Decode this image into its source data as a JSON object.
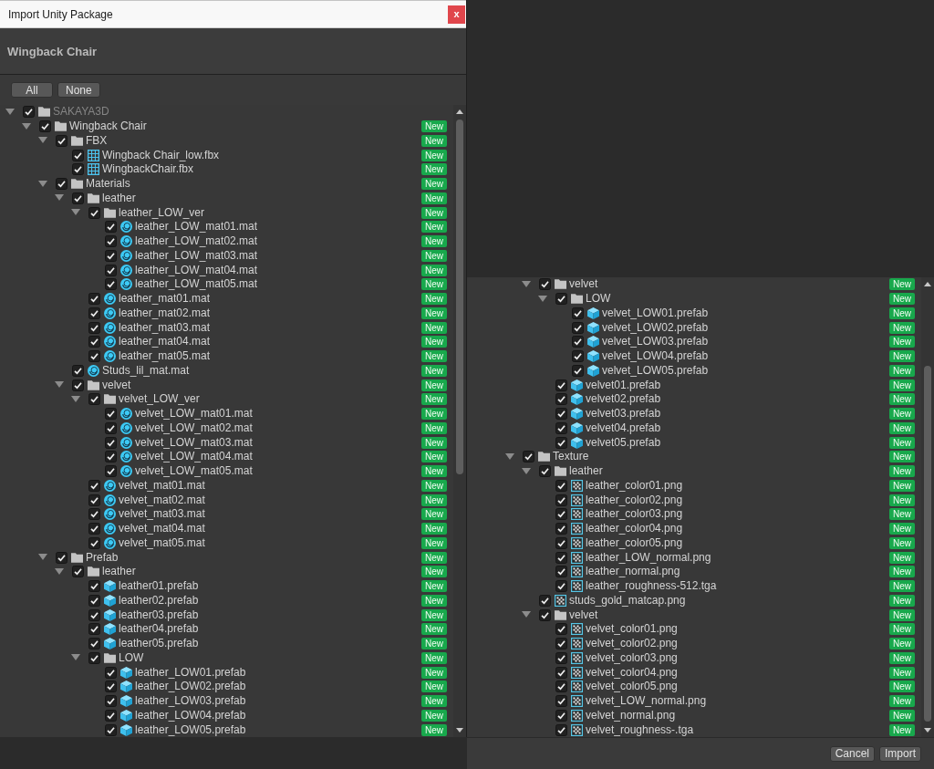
{
  "dialog_top": {
    "window": {
      "title": "Import Unity Package",
      "close": "x"
    },
    "package_title": "Wingback Chair",
    "buttons": [
      "All",
      "None"
    ],
    "tree": [
      {
        "label": "SAKAYA3D",
        "kind": "folder",
        "checked": true,
        "disabled": true,
        "expanded": true,
        "children": [
          {
            "label": "Wingback Chair",
            "kind": "folder",
            "checked": true,
            "disabled": false,
            "badge": "New",
            "expanded": true,
            "children": [
              {
                "label": "FBX",
                "kind": "folder",
                "checked": true,
                "disabled": false,
                "badge": "New",
                "expanded": true,
                "children": [
                  {
                    "label": "Wingback Chair_low.fbx",
                    "kind": "model",
                    "checked": true,
                    "disabled": false,
                    "badge": "New"
                  },
                  {
                    "label": "WingbackChair.fbx",
                    "kind": "model",
                    "checked": true,
                    "disabled": false,
                    "badge": "New"
                  }
                ]
              },
              {
                "label": "Materials",
                "kind": "folder",
                "checked": true,
                "disabled": false,
                "badge": "New",
                "expanded": true,
                "children": [
                  {
                    "label": "leather",
                    "kind": "folder",
                    "checked": true,
                    "disabled": false,
                    "badge": "New",
                    "expanded": true,
                    "children": [
                      {
                        "label": "leather_LOW_ver",
                        "kind": "folder",
                        "checked": true,
                        "disabled": false,
                        "badge": "New",
                        "expanded": true,
                        "children": [
                          {
                            "label": "leather_LOW_mat01.mat",
                            "kind": "material",
                            "checked": true,
                            "disabled": false,
                            "badge": "New"
                          },
                          {
                            "label": "leather_LOW_mat02.mat",
                            "kind": "material",
                            "checked": true,
                            "disabled": false,
                            "badge": "New"
                          },
                          {
                            "label": "leather_LOW_mat03.mat",
                            "kind": "material",
                            "checked": true,
                            "disabled": false,
                            "badge": "New"
                          },
                          {
                            "label": "leather_LOW_mat04.mat",
                            "kind": "material",
                            "checked": true,
                            "disabled": false,
                            "badge": "New"
                          },
                          {
                            "label": "leather_LOW_mat05.mat",
                            "kind": "material",
                            "checked": true,
                            "disabled": false,
                            "badge": "New"
                          }
                        ]
                      },
                      {
                        "label": "leather_mat01.mat",
                        "kind": "material",
                        "checked": true,
                        "disabled": false,
                        "badge": "New"
                      },
                      {
                        "label": "leather_mat02.mat",
                        "kind": "material",
                        "checked": true,
                        "disabled": false,
                        "badge": "New"
                      },
                      {
                        "label": "leather_mat03.mat",
                        "kind": "material",
                        "checked": true,
                        "disabled": false,
                        "badge": "New"
                      },
                      {
                        "label": "leather_mat04.mat",
                        "kind": "material",
                        "checked": true,
                        "disabled": false,
                        "badge": "New"
                      },
                      {
                        "label": "leather_mat05.mat",
                        "kind": "material",
                        "checked": true,
                        "disabled": false,
                        "badge": "New"
                      }
                    ]
                  },
                  {
                    "label": "Studs_lil_mat.mat",
                    "kind": "material",
                    "checked": true,
                    "disabled": false,
                    "badge": "New"
                  },
                  {
                    "label": "velvet",
                    "kind": "folder",
                    "checked": true,
                    "disabled": false,
                    "badge": "New",
                    "expanded": true,
                    "children": [
                      {
                        "label": "velvet_LOW_ver",
                        "kind": "folder",
                        "checked": true,
                        "disabled": false,
                        "badge": "New",
                        "expanded": true,
                        "children": [
                          {
                            "label": "velvet_LOW_mat01.mat",
                            "kind": "material",
                            "checked": true,
                            "disabled": false,
                            "badge": "New"
                          },
                          {
                            "label": "velvet_LOW_mat02.mat",
                            "kind": "material",
                            "checked": true,
                            "disabled": false,
                            "badge": "New"
                          },
                          {
                            "label": "velvet_LOW_mat03.mat",
                            "kind": "material",
                            "checked": true,
                            "disabled": false,
                            "badge": "New"
                          },
                          {
                            "label": "velvet_LOW_mat04.mat",
                            "kind": "material",
                            "checked": true,
                            "disabled": false,
                            "badge": "New"
                          },
                          {
                            "label": "velvet_LOW_mat05.mat",
                            "kind": "material",
                            "checked": true,
                            "disabled": false,
                            "badge": "New"
                          }
                        ]
                      },
                      {
                        "label": "velvet_mat01.mat",
                        "kind": "material",
                        "checked": true,
                        "disabled": false,
                        "badge": "New"
                      },
                      {
                        "label": "velvet_mat02.mat",
                        "kind": "material",
                        "checked": true,
                        "disabled": false,
                        "badge": "New"
                      },
                      {
                        "label": "velvet_mat03.mat",
                        "kind": "material",
                        "checked": true,
                        "disabled": false,
                        "badge": "New"
                      },
                      {
                        "label": "velvet_mat04.mat",
                        "kind": "material",
                        "checked": true,
                        "disabled": false,
                        "badge": "New"
                      },
                      {
                        "label": "velvet_mat05.mat",
                        "kind": "material",
                        "checked": true,
                        "disabled": false,
                        "badge": "New"
                      }
                    ]
                  }
                ]
              },
              {
                "label": "Prefab",
                "kind": "folder",
                "checked": true,
                "disabled": false,
                "badge": "New",
                "expanded": true,
                "children": [
                  {
                    "label": "leather",
                    "kind": "folder",
                    "checked": true,
                    "disabled": false,
                    "badge": "New",
                    "expanded": true,
                    "children": [
                      {
                        "label": "leather01.prefab",
                        "kind": "prefab",
                        "checked": true,
                        "disabled": false,
                        "badge": "New"
                      },
                      {
                        "label": "leather02.prefab",
                        "kind": "prefab",
                        "checked": true,
                        "disabled": false,
                        "badge": "New"
                      },
                      {
                        "label": "leather03.prefab",
                        "kind": "prefab",
                        "checked": true,
                        "disabled": false,
                        "badge": "New"
                      },
                      {
                        "label": "leather04.prefab",
                        "kind": "prefab",
                        "checked": true,
                        "disabled": false,
                        "badge": "New"
                      },
                      {
                        "label": "leather05.prefab",
                        "kind": "prefab",
                        "checked": true,
                        "disabled": false,
                        "badge": "New"
                      },
                      {
                        "label": "LOW",
                        "kind": "folder",
                        "checked": true,
                        "disabled": false,
                        "badge": "New",
                        "expanded": true,
                        "children": [
                          {
                            "label": "leather_LOW01.prefab",
                            "kind": "prefab",
                            "checked": true,
                            "disabled": false,
                            "badge": "New"
                          },
                          {
                            "label": "leather_LOW02.prefab",
                            "kind": "prefab",
                            "checked": true,
                            "disabled": false,
                            "badge": "New"
                          },
                          {
                            "label": "leather_LOW03.prefab",
                            "kind": "prefab",
                            "checked": true,
                            "disabled": false,
                            "badge": "New"
                          },
                          {
                            "label": "leather_LOW04.prefab",
                            "kind": "prefab",
                            "checked": true,
                            "disabled": false,
                            "badge": "New"
                          },
                          {
                            "label": "leather_LOW05.prefab",
                            "kind": "prefab",
                            "checked": true,
                            "disabled": false,
                            "badge": "New"
                          }
                        ]
                      }
                    ]
                  }
                ]
              }
            ]
          }
        ]
      }
    ]
  },
  "dialog_scrolled": {
    "tree": [
      {
        "children": [
          {
            "children": [
              {
                "children": [
                  {
                    "label": "velvet",
                    "kind": "folder",
                    "checked": true,
                    "disabled": false,
                    "badge": "New",
                    "expanded": true,
                    "children": [
                      {
                        "label": "LOW",
                        "kind": "folder",
                        "checked": true,
                        "disabled": false,
                        "badge": "New",
                        "expanded": true,
                        "children": [
                          {
                            "label": "velvet_LOW01.prefab",
                            "kind": "prefab",
                            "checked": true,
                            "disabled": false,
                            "badge": "New"
                          },
                          {
                            "label": "velvet_LOW02.prefab",
                            "kind": "prefab",
                            "checked": true,
                            "disabled": false,
                            "badge": "New"
                          },
                          {
                            "label": "velvet_LOW03.prefab",
                            "kind": "prefab",
                            "checked": true,
                            "disabled": false,
                            "badge": "New"
                          },
                          {
                            "label": "velvet_LOW04.prefab",
                            "kind": "prefab",
                            "checked": true,
                            "disabled": false,
                            "badge": "New"
                          },
                          {
                            "label": "velvet_LOW05.prefab",
                            "kind": "prefab",
                            "checked": true,
                            "disabled": false,
                            "badge": "New"
                          }
                        ]
                      },
                      {
                        "label": "velvet01.prefab",
                        "kind": "prefab",
                        "checked": true,
                        "disabled": false,
                        "badge": "New"
                      },
                      {
                        "label": "velvet02.prefab",
                        "kind": "prefab",
                        "checked": true,
                        "disabled": false,
                        "badge": "New"
                      },
                      {
                        "label": "velvet03.prefab",
                        "kind": "prefab",
                        "checked": true,
                        "disabled": false,
                        "badge": "New"
                      },
                      {
                        "label": "velvet04.prefab",
                        "kind": "prefab",
                        "checked": true,
                        "disabled": false,
                        "badge": "New"
                      },
                      {
                        "label": "velvet05.prefab",
                        "kind": "prefab",
                        "checked": true,
                        "disabled": false,
                        "badge": "New"
                      }
                    ]
                  }
                ]
              },
              {
                "label": "Texture",
                "kind": "folder",
                "checked": true,
                "disabled": false,
                "badge": "New",
                "expanded": true,
                "children": [
                  {
                    "label": "leather",
                    "kind": "folder",
                    "checked": true,
                    "disabled": false,
                    "badge": "New",
                    "expanded": true,
                    "children": [
                      {
                        "label": "leather_color01.png",
                        "kind": "texture",
                        "checked": true,
                        "disabled": false,
                        "badge": "New"
                      },
                      {
                        "label": "leather_color02.png",
                        "kind": "texture",
                        "checked": true,
                        "disabled": false,
                        "badge": "New"
                      },
                      {
                        "label": "leather_color03.png",
                        "kind": "texture",
                        "checked": true,
                        "disabled": false,
                        "badge": "New"
                      },
                      {
                        "label": "leather_color04.png",
                        "kind": "texture",
                        "checked": true,
                        "disabled": false,
                        "badge": "New"
                      },
                      {
                        "label": "leather_color05.png",
                        "kind": "texture",
                        "checked": true,
                        "disabled": false,
                        "badge": "New"
                      },
                      {
                        "label": "leather_LOW_normal.png",
                        "kind": "texture",
                        "checked": true,
                        "disabled": false,
                        "badge": "New"
                      },
                      {
                        "label": "leather_normal.png",
                        "kind": "texture",
                        "checked": true,
                        "disabled": false,
                        "badge": "New"
                      },
                      {
                        "label": "leather_roughness-512.tga",
                        "kind": "texture",
                        "checked": true,
                        "disabled": false,
                        "badge": "New"
                      }
                    ]
                  },
                  {
                    "label": "studs_gold_matcap.png",
                    "kind": "texture",
                    "checked": true,
                    "disabled": false,
                    "badge": "New"
                  },
                  {
                    "label": "velvet",
                    "kind": "folder",
                    "checked": true,
                    "disabled": false,
                    "badge": "New",
                    "expanded": true,
                    "children": [
                      {
                        "label": "velvet_color01.png",
                        "kind": "texture",
                        "checked": true,
                        "disabled": false,
                        "badge": "New"
                      },
                      {
                        "label": "velvet_color02.png",
                        "kind": "texture",
                        "checked": true,
                        "disabled": false,
                        "badge": "New"
                      },
                      {
                        "label": "velvet_color03.png",
                        "kind": "texture",
                        "checked": true,
                        "disabled": false,
                        "badge": "New"
                      },
                      {
                        "label": "velvet_color04.png",
                        "kind": "texture",
                        "checked": true,
                        "disabled": false,
                        "badge": "New"
                      },
                      {
                        "label": "velvet_color05.png",
                        "kind": "texture",
                        "checked": true,
                        "disabled": false,
                        "badge": "New"
                      },
                      {
                        "label": "velvet_LOW_normal.png",
                        "kind": "texture",
                        "checked": true,
                        "disabled": false,
                        "badge": "New"
                      },
                      {
                        "label": "velvet_normal.png",
                        "kind": "texture",
                        "checked": true,
                        "disabled": false,
                        "badge": "New"
                      },
                      {
                        "label": "velvet_roughness-.tga",
                        "kind": "texture",
                        "checked": true,
                        "disabled": false,
                        "badge": "New"
                      }
                    ]
                  }
                ]
              }
            ]
          }
        ]
      }
    ],
    "buttons": [
      "Cancel",
      "Import"
    ]
  }
}
